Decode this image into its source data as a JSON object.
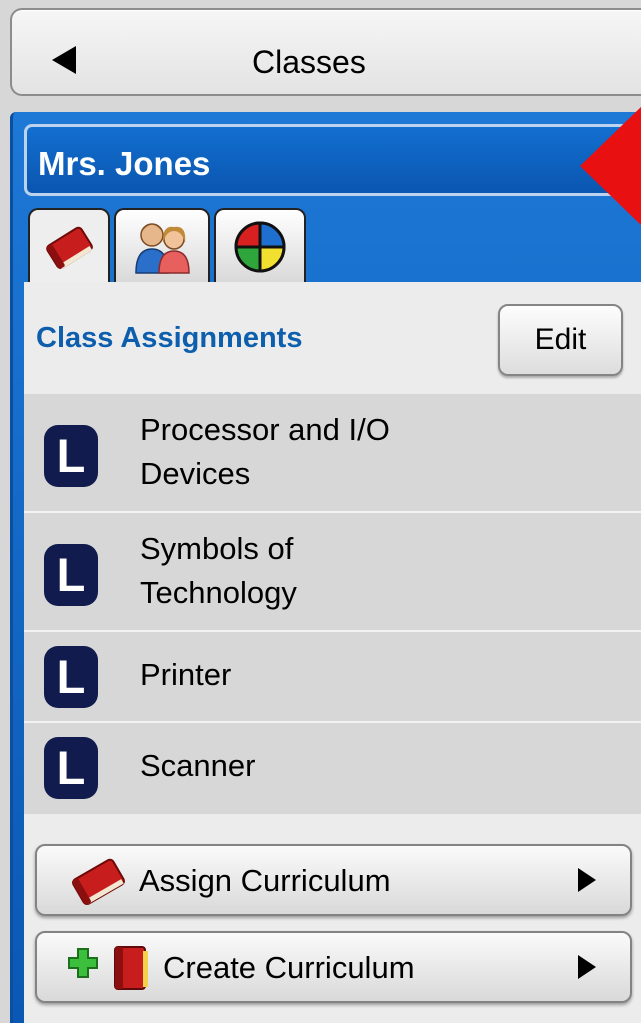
{
  "header": {
    "title": "Classes",
    "back_icon": "back-arrow-icon"
  },
  "class_selector": {
    "selected": "Mrs. Jones"
  },
  "tabs": [
    {
      "icon": "book-icon",
      "active": true
    },
    {
      "icon": "students-icon",
      "active": false
    },
    {
      "icon": "pie-chart-icon",
      "active": false
    }
  ],
  "assignments": {
    "title": "Class Assignments",
    "edit_label": "Edit",
    "items": [
      {
        "icon": "lesson-icon",
        "icon_letter": "L",
        "label": "Processor and I/O\nDevices"
      },
      {
        "icon": "lesson-icon",
        "icon_letter": "L",
        "label": "Symbols of\nTechnology"
      },
      {
        "icon": "lesson-icon",
        "icon_letter": "L",
        "label": "Printer"
      },
      {
        "icon": "lesson-icon",
        "icon_letter": "L",
        "label": "Scanner"
      }
    ]
  },
  "actions": {
    "assign_label": "Assign Curriculum",
    "create_label": "Create Curriculum"
  },
  "colors": {
    "panel_blue": "#1e78d6",
    "title_blue": "#0d5fae",
    "lesson_icon_navy": "#111b4d",
    "list_bg": "#d7d7d7"
  }
}
